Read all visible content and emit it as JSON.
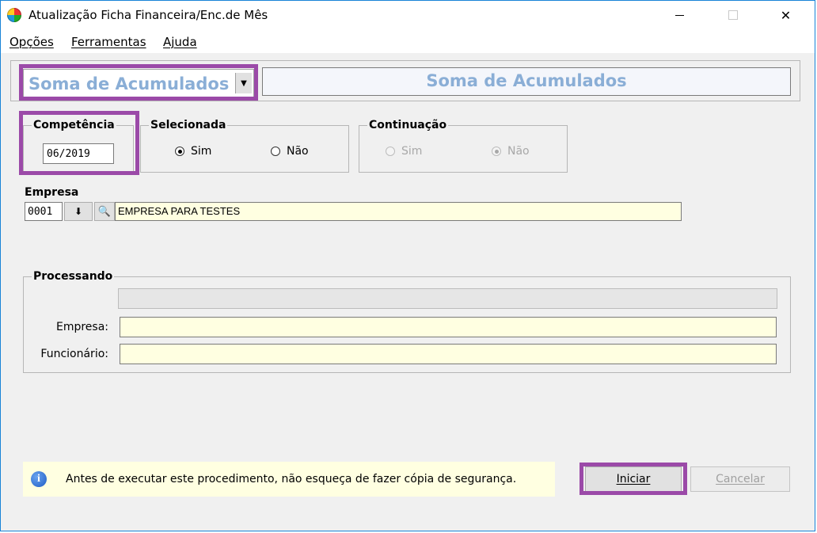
{
  "window": {
    "title": "Atualização Ficha Financeira/Enc.de Mês",
    "controls": {
      "minimize": "",
      "maximize": "",
      "close": "✕"
    }
  },
  "menu": {
    "opcoes": "Opções",
    "ferramentas": "Ferramentas",
    "ajuda": "Ajuda"
  },
  "top": {
    "combo_value": "Soma de Acumulados",
    "combo_arrow": "▼",
    "banner_title": "Soma de Acumulados"
  },
  "competencia": {
    "label": "Competência",
    "value": "06/2019"
  },
  "selecionada": {
    "label": "Selecionada",
    "options": [
      {
        "label": "Sim",
        "checked": true
      },
      {
        "label": "Não",
        "checked": false
      }
    ]
  },
  "continuacao": {
    "label": "Continuação",
    "options": [
      {
        "label": "Sim",
        "checked": false
      },
      {
        "label": "Não",
        "checked": true
      }
    ]
  },
  "empresa": {
    "label": "Empresa",
    "code": "0001",
    "download_glyph": "⬇",
    "search_glyph": "🔍",
    "name": "EMPRESA PARA TESTES"
  },
  "processando": {
    "label": "Processando",
    "progress": 0,
    "empresa_label": "Empresa:",
    "empresa_value": "",
    "funcionario_label": "Funcionário:",
    "funcionario_value": ""
  },
  "info": {
    "icon": "i",
    "message": "Antes de executar este procedimento, não esqueça de fazer cópia de segurança."
  },
  "buttons": {
    "iniciar": "Iniciar",
    "cancelar": "Cancelar"
  },
  "colors": {
    "highlight": "#9b4aa8",
    "accent_text": "#8aaed6",
    "field_yellow": "#ffffe1",
    "window_bg": "#f0f0f0"
  }
}
